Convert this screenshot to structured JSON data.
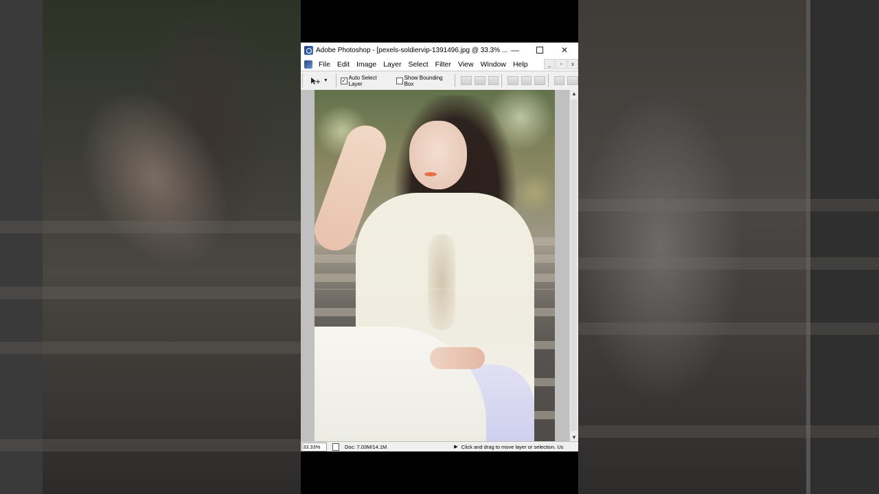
{
  "window": {
    "title": "Adobe Photoshop - [pexels-soldiervip-1391496.jpg @ 33.3% ...",
    "minimize_glyph": "—",
    "close_glyph": "✕"
  },
  "menu": {
    "items": [
      "File",
      "Edit",
      "Image",
      "Layer",
      "Select",
      "Filter",
      "View",
      "Window",
      "Help"
    ]
  },
  "options_bar": {
    "tool": "move-tool",
    "auto_select_label": "Auto Select Layer",
    "auto_select_checked": true,
    "check_glyph": "✓",
    "bounding_box_label": "Show Bounding Box",
    "bounding_box_checked": false
  },
  "document": {
    "filename": "pexels-soldiervip-1391496.jpg",
    "zoom": "33.33%"
  },
  "status": {
    "zoom": "33.33%",
    "doc_info": "Doc: 7.03M/14.1M",
    "message": "Click and drag to move layer or selection. Us"
  },
  "icons": {
    "app": "photoshop-eye-icon",
    "move": "move-tool-icon",
    "play": "play-triangle-icon"
  }
}
